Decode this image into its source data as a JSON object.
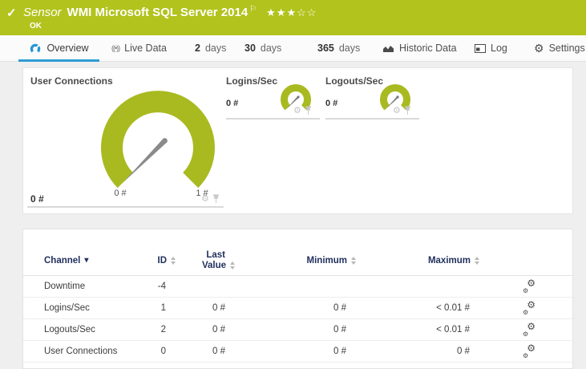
{
  "header": {
    "check_icon": "✓",
    "kind": "Sensor",
    "title": "WMI Microsoft SQL Server 2014",
    "flag": "⚐",
    "stars": "★★★☆☆",
    "status": "OK"
  },
  "tabs": {
    "overview": "Overview",
    "live_data": "Live Data",
    "d2_num": "2",
    "d2_label": "days",
    "d30_num": "30",
    "d30_label": "days",
    "d365_num": "365",
    "d365_label": "days",
    "historic": "Historic Data",
    "log": "Log",
    "settings": "Settings"
  },
  "gauges": {
    "main": {
      "label": "User Connections",
      "value": "0 #",
      "scale_min": "0 #",
      "scale_max": "1 #",
      "numeric_value": 0,
      "range": [
        0,
        1
      ],
      "unit": "#"
    },
    "logins": {
      "label": "Logins/Sec",
      "value": "0 #",
      "numeric_value": 0,
      "unit": "#"
    },
    "logouts": {
      "label": "Logouts/Sec",
      "value": "0 #",
      "numeric_value": 0,
      "unit": "#"
    }
  },
  "table": {
    "col_channel": "Channel",
    "col_id": "ID",
    "col_last_1": "Last",
    "col_last_2": "Value",
    "col_min": "Minimum",
    "col_max": "Maximum",
    "rows": [
      {
        "channel": "Downtime",
        "id": "-4",
        "last": "",
        "min": "",
        "max": ""
      },
      {
        "channel": "Logins/Sec",
        "id": "1",
        "last": "0 #",
        "min": "0 #",
        "max": "< 0.01 #"
      },
      {
        "channel": "Logouts/Sec",
        "id": "2",
        "last": "0 #",
        "min": "0 #",
        "max": "< 0.01 #"
      },
      {
        "channel": "User Connections",
        "id": "0",
        "last": "0 #",
        "min": "0 #",
        "max": "0 #"
      }
    ]
  },
  "icons": {
    "gear": "⚙",
    "caret_down": "▾",
    "live": "((•))"
  },
  "colors": {
    "header_green": "#b2c31d",
    "gauge_green": "#a9ba21",
    "tab_active_blue": "#2e9cd6",
    "table_header_navy": "#1f2f5c",
    "needle_gray": "#8a8a8a"
  }
}
